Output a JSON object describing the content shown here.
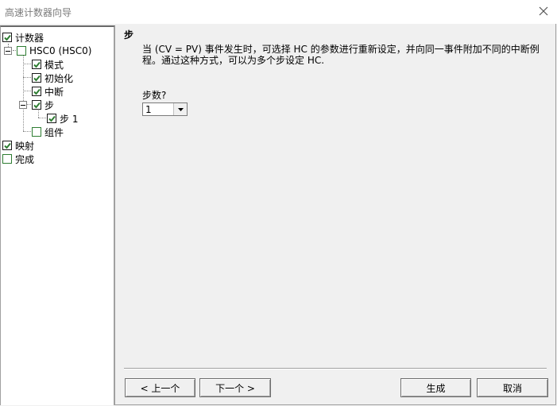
{
  "window": {
    "title": "高速计数器向导"
  },
  "tree": {
    "items": [
      {
        "label": "计数器",
        "checked": true
      },
      {
        "label": "HSC0 (HSC0)",
        "checked": false
      },
      {
        "label": "模式",
        "checked": true
      },
      {
        "label": "初始化",
        "checked": true
      },
      {
        "label": "中断",
        "checked": true
      },
      {
        "label": "步",
        "checked": true
      },
      {
        "label": "步 1",
        "checked": true
      },
      {
        "label": "组件",
        "checked": false
      },
      {
        "label": "映射",
        "checked": true
      },
      {
        "label": "完成",
        "checked": false
      }
    ]
  },
  "content": {
    "title": "步",
    "description": "当 (CV = PV) 事件发生时，可选择 HC 的参数进行重新设定，并向同一事件附加不同的中断例程。通过这种方式，可以为多个步设定 HC.",
    "steps_label": "步数?",
    "steps_value": "1"
  },
  "buttons": {
    "prev": "< 上一个",
    "next": "下一个 >",
    "generate": "生成",
    "cancel": "取消"
  },
  "colors": {
    "check_green": "#2e7d32",
    "background": "#f0f0f0"
  }
}
